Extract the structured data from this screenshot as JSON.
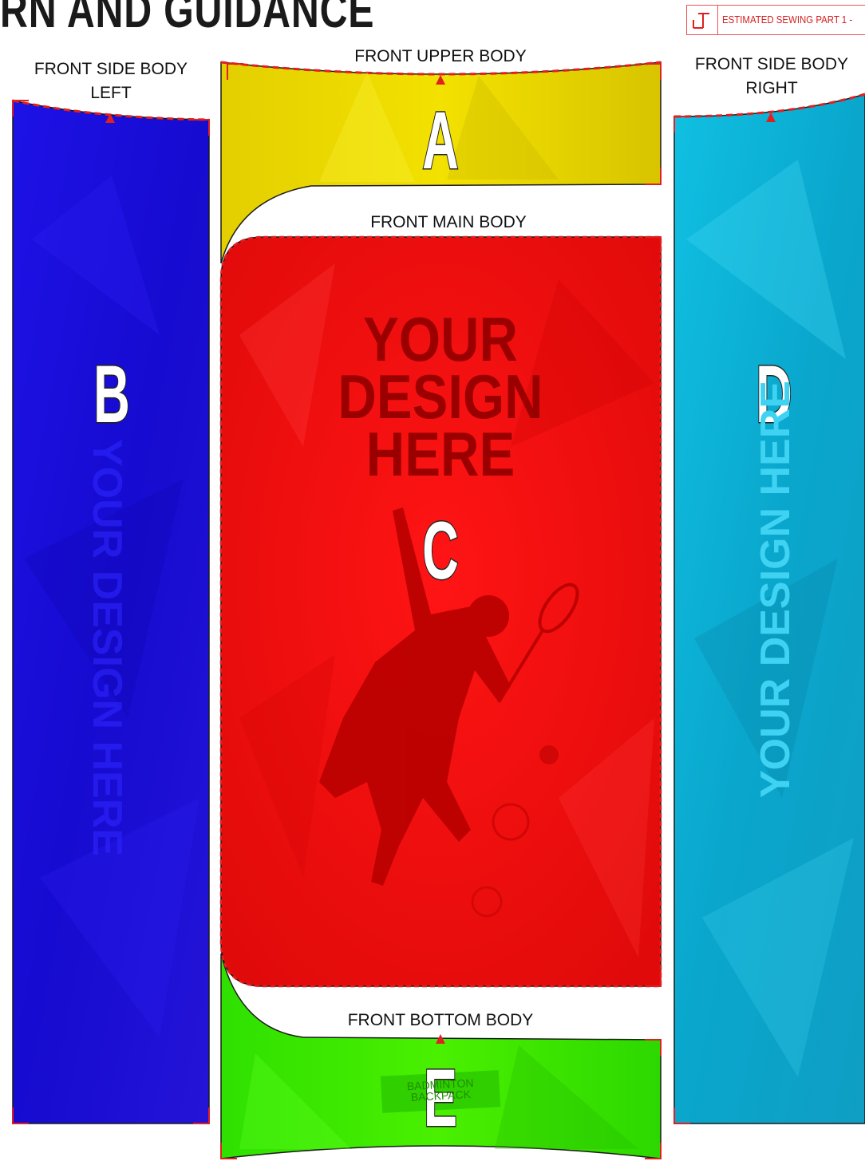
{
  "header": {
    "title": "RN AND GUIDANCE",
    "legend_label": "ESTIMATED SEWING PART 1 -"
  },
  "panels": {
    "front_side_left": {
      "label_line1": "FRONT SIDE BODY",
      "label_line2": "LEFT",
      "letter": "B",
      "design_text": "YOUR DESIGN HERE",
      "color": "#1a10d8"
    },
    "front_upper": {
      "label": "FRONT UPPER BODY",
      "letter": "A",
      "color": "#e6d400"
    },
    "front_main": {
      "label": "FRONT MAIN BODY",
      "letter": "C",
      "design_line1": "YOUR",
      "design_line2": "DESIGN",
      "design_line3": "HERE",
      "color": "#f40c0c"
    },
    "front_side_right": {
      "label_line1": "FRONT SIDE  BODY",
      "label_line2": "RIGHT",
      "letter": "D",
      "design_text": "YOUR DESIGN HERE",
      "color": "#0fb3d8"
    },
    "front_bottom": {
      "label": "FRONT BOTTOM BODY",
      "letter": "E",
      "badge_line1": "BADMINTON",
      "badge_line2": "BACKPACK",
      "color": "#34e000"
    }
  },
  "colors": {
    "seam": "#e02020",
    "outline": "#1a1a1a"
  }
}
